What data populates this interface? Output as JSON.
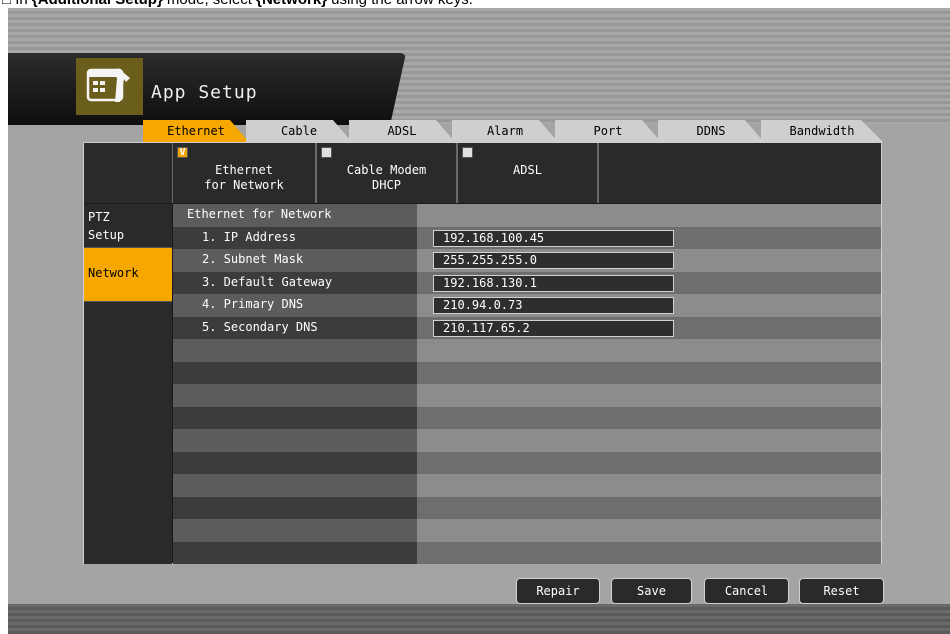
{
  "caption": {
    "prefix": "□ In ",
    "mode": "{Additional Setup}",
    "middle": " mode, select ",
    "target": "{Network}",
    "suffix": " using the arrow keys."
  },
  "window": {
    "title": "App Setup"
  },
  "tabs": [
    {
      "label": "Ethernet",
      "active": true
    },
    {
      "label": "Cable",
      "active": false
    },
    {
      "label": "ADSL",
      "active": false
    },
    {
      "label": "Alarm",
      "active": false
    },
    {
      "label": "Port",
      "active": false
    },
    {
      "label": "DDNS",
      "active": false
    },
    {
      "label": "Bandwidth",
      "active": false
    }
  ],
  "options": [
    {
      "label": "Ethernet\nfor Network",
      "checked": true,
      "mark": "V"
    },
    {
      "label": "Cable Modem\nDHCP",
      "checked": false,
      "mark": ""
    },
    {
      "label": "ADSL",
      "checked": false,
      "mark": ""
    },
    {
      "label": "",
      "checked": false,
      "mark": ""
    }
  ],
  "sidebar": [
    {
      "label": "PTZ\nSetup",
      "active": false
    },
    {
      "label": "Network",
      "active": true
    }
  ],
  "section_title": "Ethernet for Network",
  "settings": [
    {
      "label": "1. IP Address",
      "value": "192.168.100.45"
    },
    {
      "label": "2. Subnet Mask",
      "value": "255.255.255.0"
    },
    {
      "label": "3. Default Gateway",
      "value": "192.168.130.1"
    },
    {
      "label": "4. Primary DNS",
      "value": "210.94.0.73"
    },
    {
      "label": "5. Secondary DNS",
      "value": "210.117.65.2"
    }
  ],
  "buttons": {
    "repair": "Repair",
    "save": "Save",
    "cancel": "Cancel",
    "reset": "Reset"
  },
  "colors": {
    "accent": "#f6a800",
    "panel": "#a4a4a4",
    "dark": "#2a2a2a"
  }
}
